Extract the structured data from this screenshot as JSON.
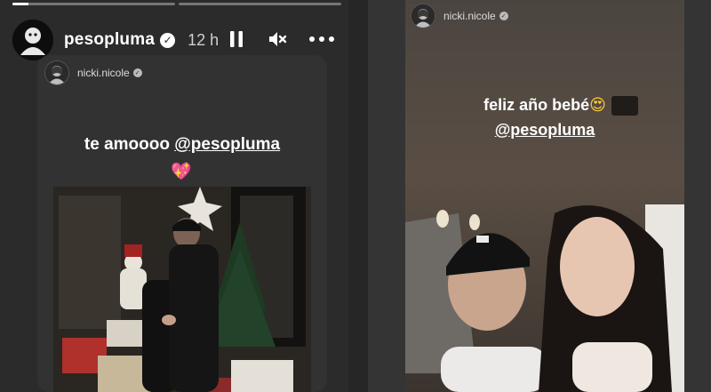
{
  "left_story": {
    "progress": [
      0.1,
      0
    ],
    "user": {
      "username": "pesopluma",
      "verified_mark": "✓",
      "time_ago": "12 h",
      "avatar_icon": "avatar-icon"
    },
    "controls": {
      "pause_icon": "pause-icon",
      "mute_icon": "mute-icon",
      "more_icon": "more-icon",
      "more_label": "•••"
    },
    "reposted": {
      "username": "nicki.nicole",
      "verified_mark": "✓",
      "caption_prefix": "te amoooo ",
      "caption_mention": "@pesopluma",
      "caption_emoji": "💖"
    }
  },
  "right_story": {
    "user": {
      "username": "nicki.nicole",
      "verified_mark": "✓"
    },
    "caption_line1": "feliz año bebé",
    "caption_emoji": "😍",
    "caption_mention": "@pesopluma"
  },
  "colors": {
    "background": "#262626",
    "card": "#323232",
    "heart": "#ff4fa3"
  }
}
